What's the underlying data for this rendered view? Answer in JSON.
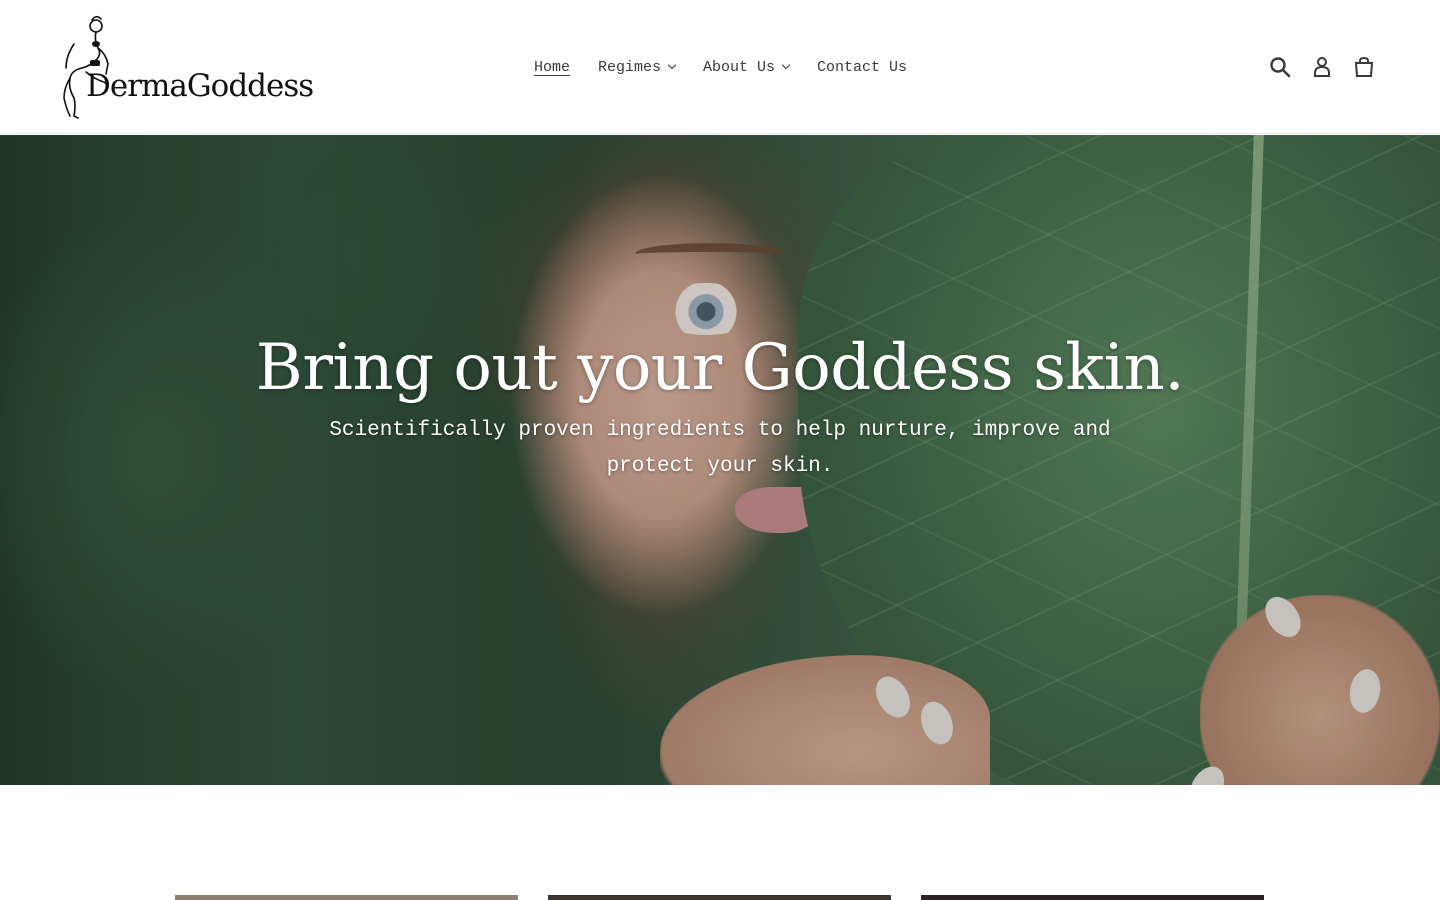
{
  "header": {
    "brand_name": "DermaGoddess",
    "nav": [
      {
        "label": "Home",
        "active": true,
        "has_dropdown": false
      },
      {
        "label": "Regimes",
        "active": false,
        "has_dropdown": true
      },
      {
        "label": "About Us",
        "active": false,
        "has_dropdown": true
      },
      {
        "label": "Contact Us",
        "active": false,
        "has_dropdown": false
      }
    ],
    "icons": [
      "search-icon",
      "account-icon",
      "cart-icon"
    ]
  },
  "hero": {
    "title": "Bring out your Goddess skin.",
    "subtitle": "Scientifically proven ingredients to help nurture, improve and protect your skin."
  },
  "colors": {
    "text": "#3a3a3a",
    "hero_text": "#ffffff",
    "leaf_green": "#4b7552"
  }
}
